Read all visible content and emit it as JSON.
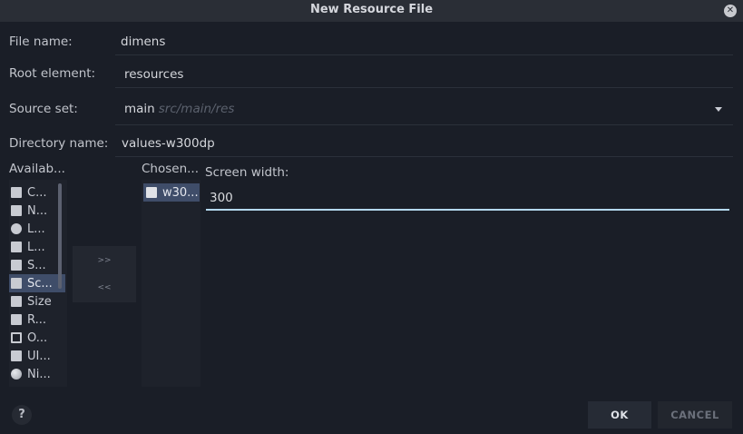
{
  "window": {
    "title": "New Resource File"
  },
  "form": {
    "file_name_label": "File name:",
    "file_name_value": "dimens",
    "root_element_label": "Root element:",
    "root_element_value": "resources",
    "source_set_label": "Source set:",
    "source_set_value": "main",
    "source_set_hint": "src/main/res",
    "directory_name_label": "Directory name:",
    "directory_name_value": "values-w300dp"
  },
  "available": {
    "header": "Availab...",
    "items": [
      {
        "label": "C...",
        "icon": "country-code-icon",
        "selected": false
      },
      {
        "label": "N...",
        "icon": "network-code-icon",
        "selected": false
      },
      {
        "label": "L...",
        "icon": "locale-globe-icon",
        "selected": false
      },
      {
        "label": "L...",
        "icon": "layout-direction-icon",
        "selected": false
      },
      {
        "label": "S...",
        "icon": "smallest-width-icon",
        "selected": false
      },
      {
        "label": "Sc...",
        "icon": "screen-width-icon",
        "selected": true
      },
      {
        "label": "Size",
        "icon": "size-icon",
        "selected": false
      },
      {
        "label": "R...",
        "icon": "ratio-icon",
        "selected": false
      },
      {
        "label": "O...",
        "icon": "orientation-icon",
        "selected": false
      },
      {
        "label": "UI...",
        "icon": "ui-mode-icon",
        "selected": false
      },
      {
        "label": "Ni...",
        "icon": "night-mode-icon",
        "selected": false
      }
    ]
  },
  "transfer": {
    "add_label": ">>",
    "remove_label": "<<"
  },
  "chosen": {
    "header": "Chosen...",
    "items": [
      {
        "label": "w30...",
        "icon": "screen-width-icon"
      }
    ]
  },
  "qualifier": {
    "label": "Screen width:",
    "value": "300"
  },
  "footer": {
    "help_label": "?",
    "ok_label": "OK",
    "cancel_label": "CANCEL"
  },
  "colors": {
    "background": "#1a1e27",
    "selection": "#3f4d69",
    "focus_underline": "#b4d8ee"
  }
}
